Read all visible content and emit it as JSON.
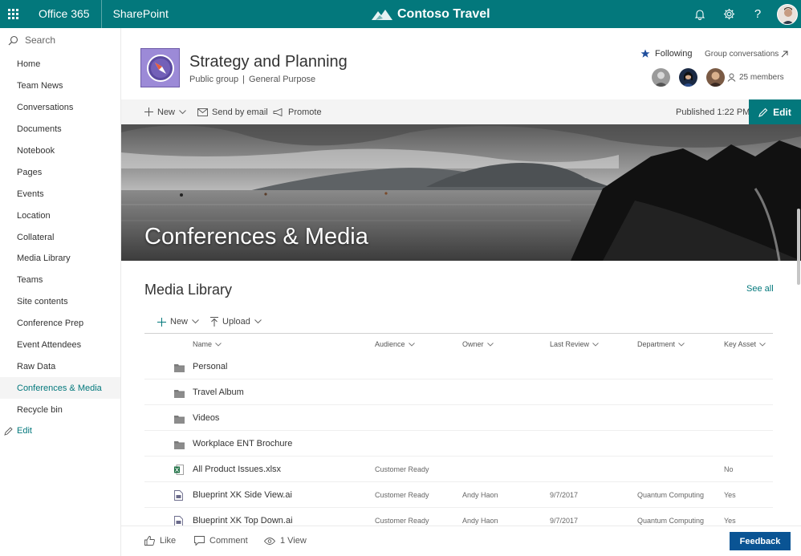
{
  "suite": {
    "app_launcher_icon": "waffle-icon",
    "office": "Office 365",
    "sharepoint": "SharePoint",
    "brand": "Contoso Travel",
    "icons": [
      "bell-icon",
      "gear-icon",
      "help-icon"
    ]
  },
  "nav": {
    "search_placeholder": "Search",
    "items": [
      {
        "label": "Home"
      },
      {
        "label": "Team News"
      },
      {
        "label": "Conversations"
      },
      {
        "label": "Documents"
      },
      {
        "label": "Notebook"
      },
      {
        "label": "Pages"
      },
      {
        "label": "Events"
      },
      {
        "label": "Location"
      },
      {
        "label": "Collateral"
      },
      {
        "label": "Media Library"
      },
      {
        "label": "Teams"
      },
      {
        "label": "Site contents"
      },
      {
        "label": "Conference Prep"
      },
      {
        "label": "Event Attendees"
      },
      {
        "label": "Raw Data"
      },
      {
        "label": "Conferences & Media"
      },
      {
        "label": "Recycle bin"
      }
    ],
    "active_index": 15,
    "edit": "Edit"
  },
  "site": {
    "title": "Strategy and Planning",
    "privacy": "Public group",
    "classification": "General Purpose",
    "separator": "|",
    "following": "Following",
    "group_conversations": "Group conversations",
    "members": "25 members"
  },
  "commandbar": {
    "new": "New",
    "send_email": "Send by email",
    "promote": "Promote",
    "published": "Published 1:22 PM",
    "edit": "Edit"
  },
  "hero": {
    "title": "Conferences & Media"
  },
  "library": {
    "title": "Media Library",
    "see_all": "See all",
    "new": "New",
    "upload": "Upload",
    "columns": {
      "name": "Name",
      "audience": "Audience",
      "owner": "Owner",
      "last_review": "Last Review",
      "department": "Department",
      "key_asset": "Key Asset"
    },
    "rows": [
      {
        "type": "folder",
        "name": "Personal",
        "audience": "",
        "owner": "",
        "last_review": "",
        "department": "",
        "key_asset": ""
      },
      {
        "type": "folder",
        "name": "Travel Album",
        "audience": "",
        "owner": "",
        "last_review": "",
        "department": "",
        "key_asset": ""
      },
      {
        "type": "folder",
        "name": "Videos",
        "audience": "",
        "owner": "",
        "last_review": "",
        "department": "",
        "key_asset": ""
      },
      {
        "type": "folder",
        "name": "Workplace ENT Brochure",
        "audience": "",
        "owner": "",
        "last_review": "",
        "department": "",
        "key_asset": ""
      },
      {
        "type": "excel",
        "name": "All Product Issues.xlsx",
        "audience": "Customer Ready",
        "owner": "",
        "last_review": "",
        "department": "",
        "key_asset": "No"
      },
      {
        "type": "file",
        "name": "Blueprint XK Side View.ai",
        "audience": "Customer Ready",
        "owner": "Andy Haon",
        "last_review": "9/7/2017",
        "department": "Quantum Computing",
        "key_asset": "Yes"
      },
      {
        "type": "file",
        "name": "Blueprint XK Top Down.ai",
        "audience": "Customer Ready",
        "owner": "Andy Haon",
        "last_review": "9/7/2017",
        "department": "Quantum Computing",
        "key_asset": "Yes"
      }
    ]
  },
  "footer": {
    "like": "Like",
    "comment": "Comment",
    "views": "1 View",
    "feedback": "Feedback"
  },
  "colors": {
    "accent": "#03787c",
    "feedback": "#0a5494"
  }
}
